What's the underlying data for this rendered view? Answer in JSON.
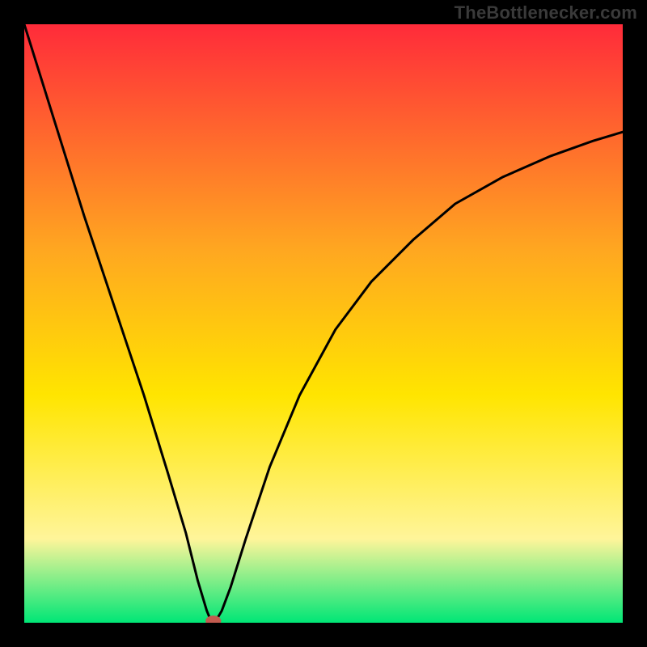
{
  "watermark": "TheBottlenecker.com",
  "chart_data": {
    "type": "line",
    "title": "",
    "xlabel": "",
    "ylabel": "",
    "xlim": [
      0,
      100
    ],
    "ylim": [
      0,
      100
    ],
    "grid": false,
    "legend": false,
    "background_gradient": {
      "top": "#ff2b3a",
      "mid_upper": "#ffa820",
      "mid": "#ffe500",
      "mid_lower": "#fff59a",
      "bottom": "#00e676"
    },
    "series": [
      {
        "name": "curve",
        "x": [
          0,
          5,
          10,
          15,
          20,
          24,
          27,
          29,
          30.5,
          31.2,
          32,
          33,
          34.5,
          37,
          41,
          46,
          52,
          58,
          65,
          72,
          80,
          88,
          95,
          100
        ],
        "y": [
          100,
          84,
          68,
          53,
          38,
          25,
          15,
          7,
          2,
          0.3,
          0.3,
          2,
          6,
          14,
          26,
          38,
          49,
          57,
          64,
          70,
          74.5,
          78,
          80.5,
          82
        ]
      }
    ],
    "marker": {
      "x": 31.6,
      "y": 0.3,
      "rx": 1.3,
      "ry": 0.9,
      "color": "#c25b4f"
    }
  }
}
